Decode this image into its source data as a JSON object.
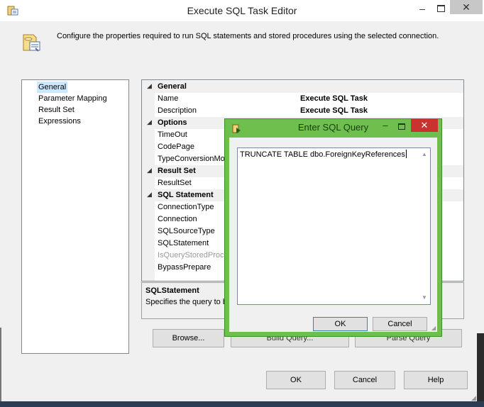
{
  "window": {
    "title": "Execute SQL Task Editor",
    "min_glyph": "–",
    "close_glyph": "✕"
  },
  "header": {
    "text": "Configure the properties required to run SQL statements and stored procedures using the selected connection."
  },
  "nav": {
    "items": [
      {
        "label": "General",
        "selected": true
      },
      {
        "label": "Parameter Mapping"
      },
      {
        "label": "Result Set"
      },
      {
        "label": "Expressions"
      }
    ]
  },
  "grid": {
    "rows": [
      {
        "type": "cat",
        "name": "General"
      },
      {
        "type": "prop",
        "name": "Name",
        "value": "Execute SQL Task"
      },
      {
        "type": "prop",
        "name": "Description",
        "value": "Execute SQL Task"
      },
      {
        "type": "cat",
        "name": "Options"
      },
      {
        "type": "prop",
        "name": "TimeOut",
        "value": ""
      },
      {
        "type": "prop",
        "name": "CodePage",
        "value": ""
      },
      {
        "type": "prop",
        "name": "TypeConversionMo",
        "value": ""
      },
      {
        "type": "cat",
        "name": "Result Set"
      },
      {
        "type": "prop",
        "name": "ResultSet",
        "value": ""
      },
      {
        "type": "cat",
        "name": "SQL Statement"
      },
      {
        "type": "prop",
        "name": "ConnectionType",
        "value": ""
      },
      {
        "type": "prop",
        "name": "Connection",
        "value": ""
      },
      {
        "type": "prop",
        "name": "SQLSourceType",
        "value": ""
      },
      {
        "type": "prop",
        "name": "SQLStatement",
        "value": ""
      },
      {
        "type": "prop",
        "name": "IsQueryStoredProce",
        "value": "",
        "dim": true
      },
      {
        "type": "prop",
        "name": "BypassPrepare",
        "value": ""
      }
    ]
  },
  "description": {
    "title": "SQLStatement",
    "text": "Specifies the query to b"
  },
  "buttons": {
    "browse": "Browse...",
    "build_query": "Build Query...",
    "parse_query": "Parse Query",
    "ok": "OK",
    "cancel": "Cancel",
    "help": "Help"
  },
  "modal": {
    "title": "Enter SQL Query",
    "sql_text": "TRUNCATE TABLE dbo.ForeignKeyReferences",
    "ok": "OK",
    "cancel": "Cancel",
    "min_glyph": "–",
    "close_glyph": "✕",
    "accent": "#6fbf4f"
  },
  "icons": {
    "window": "ssis-task-icon",
    "header": "database-task-icon",
    "modal": "sql-query-icon"
  }
}
